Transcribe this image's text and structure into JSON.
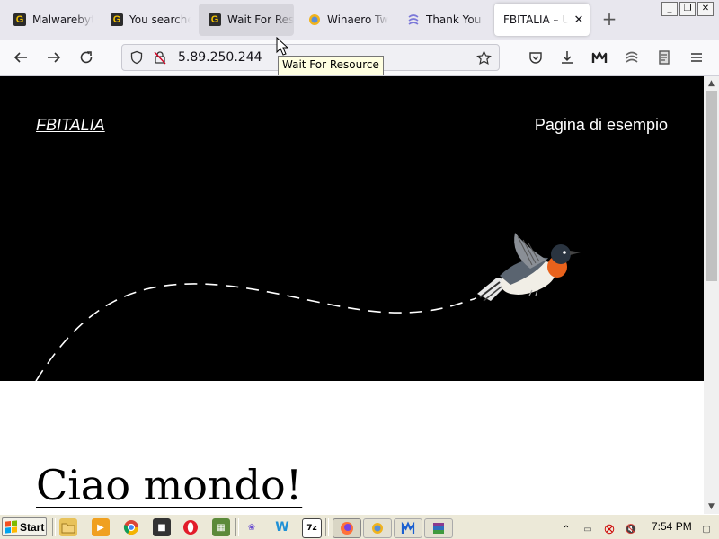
{
  "tabs": [
    {
      "title": "Malwarebytes",
      "icon": "g-favicon"
    },
    {
      "title": "You searched",
      "icon": "g-favicon"
    },
    {
      "title": "Wait For Resource",
      "icon": "g-favicon"
    },
    {
      "title": "Winaero Tweaker",
      "icon": "winaero-favicon"
    },
    {
      "title": "Thank You",
      "icon": "swirl-favicon"
    },
    {
      "title": "FBITALIA – Un",
      "icon": "none"
    }
  ],
  "tab_close_glyph": "✕",
  "new_tab_glyph": "+",
  "address": {
    "url": "5.89.250.244"
  },
  "tooltip": "Wait For Resource",
  "page": {
    "site_title": "FBITALIA",
    "nav_link": "Pagina di esempio",
    "post_title": "Ciao mondo!"
  },
  "taskbar": {
    "start_label": "Start",
    "clock": "7:54 PM",
    "start_flag_colors": [
      "#f25022",
      "#7fba00",
      "#00a4ef",
      "#ffb900"
    ]
  },
  "colors": {
    "hero_bg": "#000000",
    "tabstrip_bg": "#e8e7ee",
    "taskbar_bg": "#ece9d8"
  }
}
